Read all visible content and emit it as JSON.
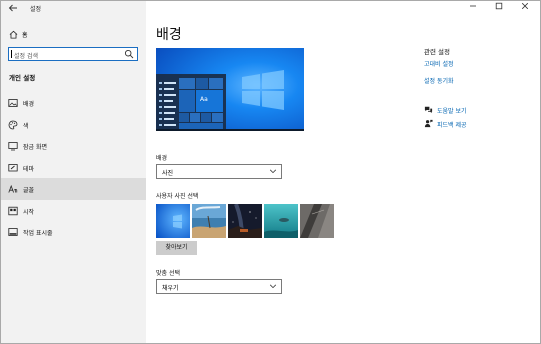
{
  "window": {
    "app_title": "설정",
    "controls": {
      "minimize": "—",
      "maximize": "☐",
      "close": "✕"
    }
  },
  "sidebar": {
    "home_label": "홈",
    "search_placeholder": "설정 검색",
    "section_title": "개인 설정",
    "items": [
      {
        "label": "배경",
        "icon": "picture-icon",
        "active": false
      },
      {
        "label": "색",
        "icon": "palette-icon",
        "active": false
      },
      {
        "label": "잠금 화면",
        "icon": "lock-screen-icon",
        "active": false
      },
      {
        "label": "테마",
        "icon": "brush-icon",
        "active": false
      },
      {
        "label": "글꼴",
        "icon": "font-icon",
        "active": true
      },
      {
        "label": "시작",
        "icon": "start-icon",
        "active": false
      },
      {
        "label": "작업 표시줄",
        "icon": "taskbar-icon",
        "active": false
      }
    ]
  },
  "main": {
    "title": "배경",
    "preview": {
      "tile_text": "Aa"
    },
    "background": {
      "label": "배경",
      "value": "사진"
    },
    "photos": {
      "label": "사용자 사진 선택",
      "browse_label": "찾아보기"
    },
    "fit": {
      "label": "맞춤 선택",
      "value": "채우기"
    }
  },
  "related": {
    "title": "관련 설정",
    "links": [
      "고대비 설정",
      "설정 동기화"
    ],
    "help": [
      {
        "label": "도움말 보기",
        "icon": "help-chat-icon"
      },
      {
        "label": "피드백 제공",
        "icon": "feedback-person-icon"
      }
    ]
  },
  "colors": {
    "accent": "#0063b1",
    "sidebar_bg": "#f2f2f2",
    "active_item_bg": "#dcdcdc",
    "desktop_blue": "#0a64d6"
  }
}
